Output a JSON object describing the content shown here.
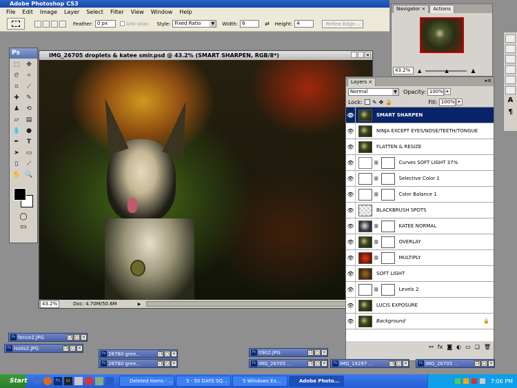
{
  "app": {
    "title": "Adobe Photoshop CS3",
    "logo": "Ps"
  },
  "menu": [
    "File",
    "Edit",
    "Image",
    "Layer",
    "Select",
    "Filter",
    "View",
    "Window",
    "Help"
  ],
  "options": {
    "feather_label": "Feather:",
    "feather_value": "0 px",
    "antialias_label": "Anti-alias",
    "style_label": "Style:",
    "style_value": "Fixed Ratio",
    "width_label": "Width:",
    "width_value": "6",
    "height_label": "Height:",
    "height_value": "4",
    "refine_label": "Refine Edge..."
  },
  "document": {
    "title": "IMG_26705 droplets & katee smlr.psd @ 43.2% (SMART SHARPEN, RGB/8*)",
    "zoom": "43.2%",
    "doc_info": "Doc: 4.70M/50.6M"
  },
  "navigator": {
    "tabs": [
      "Navigator",
      "Actions"
    ],
    "zoom": "43.2%"
  },
  "layers_panel": {
    "tab": "Layers",
    "blend_mode": "Normal",
    "opacity_label": "Opacity:",
    "opacity_value": "100%",
    "lock_label": "Lock:",
    "fill_label": "Fill:",
    "fill_value": "100%",
    "layers": [
      {
        "name": "SMART SHARPEN",
        "selected": true,
        "thumb": "photo",
        "mask": false
      },
      {
        "name": "NINJA EXCEPT EYES/NOSE/TEETH/TONGUE",
        "selected": false,
        "thumb": "photo",
        "mask": false
      },
      {
        "name": "FLATTEN & RESIZE",
        "selected": false,
        "thumb": "photo",
        "mask": false
      },
      {
        "name": "Curves SOFT LIGHT 37%",
        "selected": false,
        "thumb": "curves",
        "mask": true
      },
      {
        "name": "Selective Color 1",
        "selected": false,
        "thumb": "adjust",
        "mask": true
      },
      {
        "name": "Color Balance 1",
        "selected": false,
        "thumb": "balance",
        "mask": true
      },
      {
        "name": "BLACKBRUSH SPOTS",
        "selected": false,
        "thumb": "transparent",
        "mask": false
      },
      {
        "name": "KATEE NORMAL",
        "selected": false,
        "thumb": "dog",
        "mask": true
      },
      {
        "name": "OVERLAY",
        "selected": false,
        "thumb": "photo",
        "mask": true
      },
      {
        "name": "MULTIPLY",
        "selected": false,
        "thumb": "red",
        "mask": true
      },
      {
        "name": "SOFT LIGHT",
        "selected": false,
        "thumb": "brown",
        "mask": false
      },
      {
        "name": "Levels 2",
        "selected": false,
        "thumb": "levels",
        "mask": true
      },
      {
        "name": "LUCIS EXPOSURE",
        "selected": false,
        "thumb": "photo",
        "mask": false
      },
      {
        "name": "Background",
        "selected": false,
        "thumb": "photo",
        "mask": false,
        "italic": true
      }
    ]
  },
  "minimized_docs": [
    {
      "name": "fence2.JPG"
    },
    {
      "name": "roots2.JPG"
    },
    {
      "name": "26780 gree..."
    },
    {
      "name": "26780 gree..."
    },
    {
      "name": "0902.JPG"
    },
    {
      "name": "IMG_26705 ..."
    },
    {
      "name": "IMG_19297 ..."
    },
    {
      "name": "IMG_26705 ..."
    }
  ],
  "taskbar": {
    "start": "Start",
    "quick_launch": [
      "Ps",
      "Lr"
    ],
    "tasks": [
      {
        "label": "Deleted Items - ...",
        "active": false
      },
      {
        "label": "5 - 50 DAYS SQ...",
        "active": false
      },
      {
        "label": "5 Windows Ex...",
        "active": false
      },
      {
        "label": "Adobe Photo...",
        "active": true
      }
    ],
    "clock": "7:06 PM"
  },
  "colors": {
    "accent": "#0a246a",
    "titlebar": "#1a46a8",
    "taskbar": "#245dd7"
  }
}
